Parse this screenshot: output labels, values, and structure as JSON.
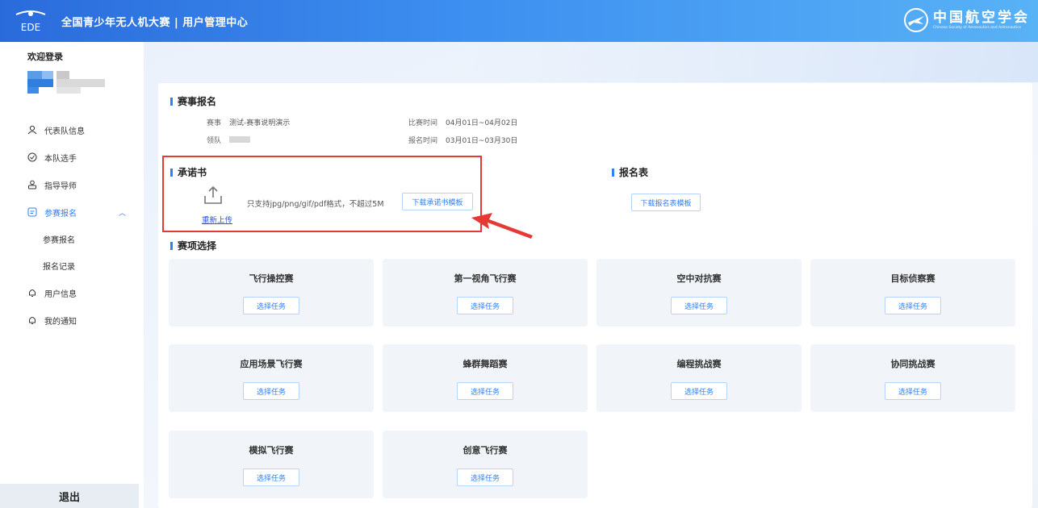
{
  "header": {
    "logo_text": "EDE",
    "app_title": "全国青少年无人机大赛 | 用户管理中心",
    "org_name_cn": "中国航空学会",
    "org_name_en": "Chinese Society of Aeronautics and Astronautics"
  },
  "sidebar": {
    "welcome": "欢迎登录",
    "items": [
      {
        "label": "代表队信息",
        "icon": "user-icon"
      },
      {
        "label": "本队选手",
        "icon": "team-icon"
      },
      {
        "label": "指导导师",
        "icon": "mentor-icon"
      },
      {
        "label": "参赛报名",
        "icon": "form-icon",
        "active": true
      },
      {
        "label": "参赛报名",
        "sub": true
      },
      {
        "label": "报名记录",
        "sub": true
      },
      {
        "label": "用户信息",
        "icon": "bell-icon"
      },
      {
        "label": "我的通知",
        "icon": "bell-icon"
      }
    ],
    "logout": "退出"
  },
  "registration": {
    "section_title": "赛事报名",
    "event_key": "赛事",
    "event_value": "测试-赛事说明演示",
    "leader_key": "领队",
    "match_time_key": "比赛时间",
    "match_time_value": "04月01日~04月02日",
    "signup_time_key": "报名时间",
    "signup_time_value": "03月01日~03月30日"
  },
  "commitment": {
    "section_title": "承诺书",
    "reupload_label": "重新上传",
    "hint": "只支持jpg/png/gif/pdf格式，不超过5M",
    "download_label": "下载承诺书模板"
  },
  "signup_form": {
    "section_title": "报名表",
    "download_label": "下载报名表模板"
  },
  "events": {
    "section_title": "赛项选择",
    "select_label": "选择任务",
    "items": [
      {
        "name": "飞行操控赛"
      },
      {
        "name": "第一视角飞行赛"
      },
      {
        "name": "空中对抗赛"
      },
      {
        "name": "目标侦察赛"
      },
      {
        "name": "应用场景飞行赛"
      },
      {
        "name": "蜂群舞蹈赛"
      },
      {
        "name": "编程挑战赛"
      },
      {
        "name": "协同挑战赛"
      },
      {
        "name": "模拟飞行赛"
      },
      {
        "name": "创意飞行赛"
      }
    ]
  },
  "colors": {
    "accent": "#2f7ff5",
    "highlight": "#e53935",
    "header_start": "#2a6bdb",
    "header_end": "#58b2f6"
  }
}
